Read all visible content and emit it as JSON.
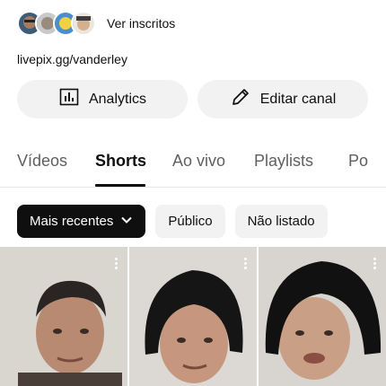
{
  "subscribers": {
    "label": "Ver inscritos",
    "avatar_icons": [
      "avatar-1",
      "avatar-2",
      "avatar-3",
      "avatar-4"
    ]
  },
  "channel": {
    "link": "livepix.gg/vanderley"
  },
  "actions": {
    "analytics": {
      "label": "Analytics",
      "icon": "analytics-icon"
    },
    "edit": {
      "label": "Editar canal",
      "icon": "pencil-icon"
    }
  },
  "tabs": [
    {
      "label": "Vídeos",
      "active": false
    },
    {
      "label": "Shorts",
      "active": true
    },
    {
      "label": "Ao vivo",
      "active": false
    },
    {
      "label": "Playlists",
      "active": false
    },
    {
      "label": "Po",
      "active": false
    }
  ],
  "filters": {
    "sort_label": "Mais recentes",
    "chips": [
      "Público",
      "Não listado"
    ]
  },
  "shorts": [
    {
      "thumbnail": "short-thumbnail-1"
    },
    {
      "thumbnail": "short-thumbnail-2"
    },
    {
      "thumbnail": "short-thumbnail-3"
    }
  ],
  "colors": {
    "text": "#0f0f0f",
    "secondary": "#606060",
    "chip_bg": "#f2f2f2",
    "selected_chip": "#0f0f0f"
  }
}
